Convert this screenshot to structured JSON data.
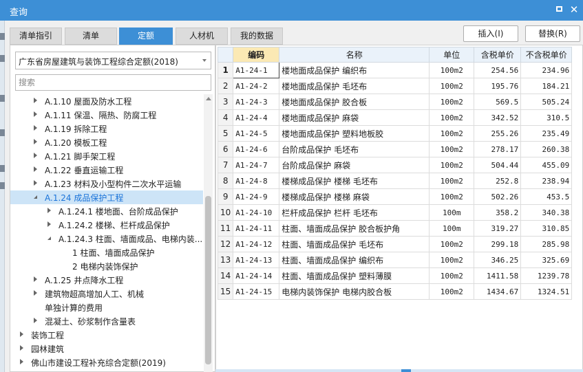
{
  "window": {
    "title": "查询"
  },
  "tabs": [
    {
      "label": "清单指引",
      "active": false
    },
    {
      "label": "清单",
      "active": false
    },
    {
      "label": "定额",
      "active": true
    },
    {
      "label": "人材机",
      "active": false
    },
    {
      "label": "我的数据",
      "active": false
    }
  ],
  "actions": {
    "insert_label": "插入(I)",
    "replace_label": "替换(R)"
  },
  "library": {
    "selected": "广东省房屋建筑与装饰工程综合定额(2018)"
  },
  "search": {
    "placeholder": "搜索"
  },
  "tree": [
    {
      "label": "A.1.10 屋面及防水工程",
      "level": 2,
      "toggle": "collapsed"
    },
    {
      "label": "A.1.11 保温、隔热、防腐工程",
      "level": 2,
      "toggle": "collapsed"
    },
    {
      "label": "A.1.19 拆除工程",
      "level": 2,
      "toggle": "collapsed"
    },
    {
      "label": "A.1.20 模板工程",
      "level": 2,
      "toggle": "collapsed"
    },
    {
      "label": "A.1.21 脚手架工程",
      "level": 2,
      "toggle": "collapsed"
    },
    {
      "label": "A.1.22 垂直运输工程",
      "level": 2,
      "toggle": "collapsed"
    },
    {
      "label": "A.1.23 材料及小型构件二次水平运输",
      "level": 2,
      "toggle": "collapsed"
    },
    {
      "label": "A.1.24 成品保护工程",
      "level": 2,
      "toggle": "expanded",
      "selected": true
    },
    {
      "label": "A.1.24.1 楼地面、台阶成品保护",
      "level": 3,
      "toggle": "collapsed"
    },
    {
      "label": "A.1.24.2 楼梯、栏杆成品保护",
      "level": 3,
      "toggle": "collapsed"
    },
    {
      "label": "A.1.24.3 柱面、墙面成品、电梯内装...",
      "level": 3,
      "toggle": "expanded"
    },
    {
      "label": "1 柱面、墙面成品保护",
      "level": 4,
      "toggle": "none"
    },
    {
      "label": "2 电梯内装饰保护",
      "level": 4,
      "toggle": "none"
    },
    {
      "label": "A.1.25 井点降水工程",
      "level": 2,
      "toggle": "collapsed"
    },
    {
      "label": "建筑物超高增加人工、机械",
      "level": 2,
      "toggle": "collapsed"
    },
    {
      "label": "单独计算的费用",
      "level": 2,
      "toggle": "none"
    },
    {
      "label": "混凝土、砂浆制作含量表",
      "level": 2,
      "toggle": "collapsed"
    },
    {
      "label": "装饰工程",
      "level": 1,
      "toggle": "collapsed"
    },
    {
      "label": "园林建筑",
      "level": 1,
      "toggle": "collapsed"
    },
    {
      "label": "佛山市建设工程补充综合定额(2019)",
      "level": 1,
      "toggle": "collapsed"
    }
  ],
  "grid": {
    "columns": [
      "",
      "编码",
      "名称",
      "单位",
      "含税单价",
      "不含税单价"
    ],
    "rows": [
      {
        "n": "1",
        "code": "A1-24-1",
        "name": "楼地面成品保护 编织布",
        "unit": "100m2",
        "price_tax": "254.56",
        "price_notax": "234.96"
      },
      {
        "n": "2",
        "code": "A1-24-2",
        "name": "楼地面成品保护 毛坯布",
        "unit": "100m2",
        "price_tax": "195.76",
        "price_notax": "184.21"
      },
      {
        "n": "3",
        "code": "A1-24-3",
        "name": "楼地面成品保护 胶合板",
        "unit": "100m2",
        "price_tax": "569.5",
        "price_notax": "505.24"
      },
      {
        "n": "4",
        "code": "A1-24-4",
        "name": "楼地面成品保护 麻袋",
        "unit": "100m2",
        "price_tax": "342.52",
        "price_notax": "310.5"
      },
      {
        "n": "5",
        "code": "A1-24-5",
        "name": "楼地面成品保护 塑料地板胶",
        "unit": "100m2",
        "price_tax": "255.26",
        "price_notax": "235.49"
      },
      {
        "n": "6",
        "code": "A1-24-6",
        "name": "台阶成品保护 毛坯布",
        "unit": "100m2",
        "price_tax": "278.17",
        "price_notax": "260.38"
      },
      {
        "n": "7",
        "code": "A1-24-7",
        "name": "台阶成品保护 麻袋",
        "unit": "100m2",
        "price_tax": "504.44",
        "price_notax": "455.09"
      },
      {
        "n": "8",
        "code": "A1-24-8",
        "name": "楼梯成品保护 楼梯 毛坯布",
        "unit": "100m2",
        "price_tax": "252.8",
        "price_notax": "238.94"
      },
      {
        "n": "9",
        "code": "A1-24-9",
        "name": "楼梯成品保护 楼梯 麻袋",
        "unit": "100m2",
        "price_tax": "502.26",
        "price_notax": "453.5"
      },
      {
        "n": "10",
        "code": "A1-24-10",
        "name": "栏杆成品保护 栏杆 毛坯布",
        "unit": "100m",
        "price_tax": "358.2",
        "price_notax": "340.38"
      },
      {
        "n": "11",
        "code": "A1-24-11",
        "name": "柱面、墙面成品保护 胶合板护角",
        "unit": "100m",
        "price_tax": "319.27",
        "price_notax": "310.85"
      },
      {
        "n": "12",
        "code": "A1-24-12",
        "name": "柱面、墙面成品保护 毛坯布",
        "unit": "100m2",
        "price_tax": "299.18",
        "price_notax": "285.98"
      },
      {
        "n": "13",
        "code": "A1-24-13",
        "name": "柱面、墙面成品保护 编织布",
        "unit": "100m2",
        "price_tax": "346.25",
        "price_notax": "325.69"
      },
      {
        "n": "14",
        "code": "A1-24-14",
        "name": "柱面、墙面成品保护 塑料薄膜",
        "unit": "100m2",
        "price_tax": "1411.58",
        "price_notax": "1239.78"
      },
      {
        "n": "15",
        "code": "A1-24-15",
        "name": "电梯内装饰保护 电梯内胶合板",
        "unit": "100m2",
        "price_tax": "1434.67",
        "price_notax": "1324.51"
      }
    ]
  },
  "colors": {
    "accent": "#3d8fd6",
    "selected_row": "#cde4f7",
    "code_header": "#fbe9b4"
  },
  "icons": {
    "maximize": "maximize-icon",
    "close": "close-icon"
  }
}
